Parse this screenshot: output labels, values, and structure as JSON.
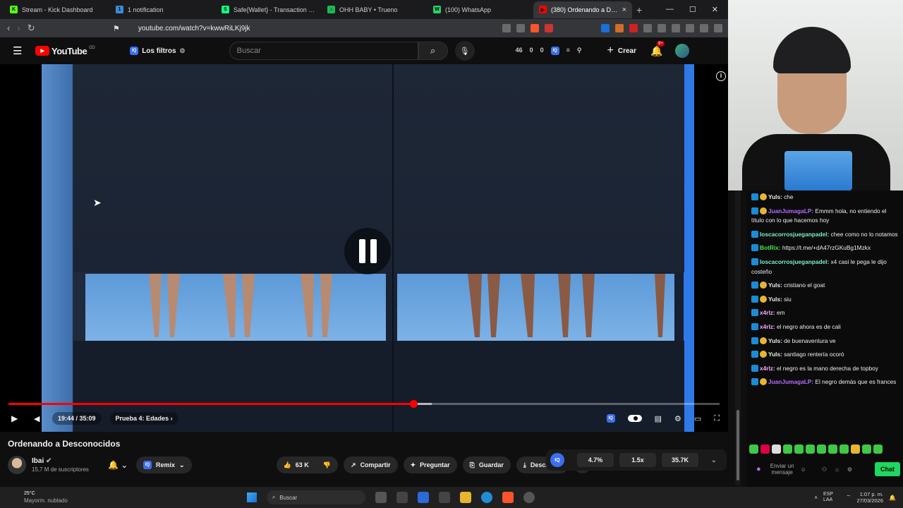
{
  "browser": {
    "tabs": [
      {
        "title": "Stream - Kick Dashboard",
        "icon_color": "#53fc18",
        "icon": "K"
      },
      {
        "title": "1 notification",
        "icon_color": "#3b8bd8",
        "icon": "1"
      },
      {
        "title": "Safe{Wallet} - Transaction queue",
        "icon_color": "#12ff80",
        "icon": "S"
      },
      {
        "title": "OHH BABY • Trueno",
        "icon_color": "#1db954",
        "icon": "♪"
      },
      {
        "title": "(100) WhatsApp",
        "icon_color": "#25d366",
        "icon": "W"
      },
      {
        "title": "(380) Ordenando a Desco...",
        "icon_color": "#ff0000",
        "icon": "▶",
        "active": true
      }
    ],
    "new_tab": "+",
    "url": "youtube.com/watch?v=kwwRiLKj9jk"
  },
  "yt_header": {
    "logo": "YouTube",
    "country": "CO",
    "filters_label": "Los filtros",
    "search_placeholder": "Buscar",
    "stats": [
      "46",
      "0",
      "0"
    ],
    "create_label": "Crear",
    "notifications": "9+"
  },
  "player": {
    "time": "19:44 / 35:09",
    "chapter": "Prueba 4: Edades",
    "progress_fraction": 0.5693,
    "buffered_fraction": 0.5952
  },
  "video": {
    "title": "Ordenando a Desconocidos",
    "channel": "Ibai",
    "subscribers": "15,7 M de suscriptores",
    "remix": "Remix",
    "likes": "63 K",
    "share": "Compartir",
    "ask": "Preguntar",
    "save": "Guardar",
    "download": "Descargar"
  },
  "iq_widget": {
    "stats": [
      "4.7%",
      "1.5x",
      "35.7K"
    ]
  },
  "chat": {
    "messages": [
      {
        "user": "Yuls:",
        "text": "che",
        "color": "#e9e9e9"
      },
      {
        "user": "JuanJumagaLP:",
        "text": "Emmm hola, no entiendo el título con lo que hacemos hoy",
        "color": "#b46cff"
      },
      {
        "user": "loscacorrosjueganpadel:",
        "text": "chee como no lo notamos",
        "color": "#7cf0c8"
      },
      {
        "user": "BotRix:",
        "text": "https://t.me/+dA47rzGKuBg1Mzkx",
        "color": "#49e44b"
      },
      {
        "user": "loscacorrosjueganpadel:",
        "text": "x4 casi le pega le dijo costeño",
        "color": "#7cf0c8"
      },
      {
        "user": "Yuls:",
        "text": "cristiano el goat",
        "color": "#e9e9e9"
      },
      {
        "user": "Yuls:",
        "text": "siu",
        "color": "#e9e9e9"
      },
      {
        "user": "x4rlz:",
        "text": "em",
        "color": "#f0a8ff"
      },
      {
        "user": "x4rlz:",
        "text": "el negro ahora es de cali",
        "color": "#f0a8ff"
      },
      {
        "user": "Yuls:",
        "text": "de buenaventura ve",
        "color": "#e9e9e9"
      },
      {
        "user": "Yuls:",
        "text": "santiago rentería ocoró",
        "color": "#e9e9e9"
      },
      {
        "user": "x4rlz:",
        "text": "el negro es la mano derecha de topboy",
        "color": "#f0a8ff"
      },
      {
        "user": "JuanJumagaLP:",
        "text": "El negro demás que es frances",
        "color": "#b46cff"
      }
    ],
    "input_placeholder": "Enviar un mensaje",
    "send_label": "Chat"
  },
  "taskbar": {
    "temperature": "25°C",
    "weather": "Mayorm. nublado",
    "search": "Buscar",
    "lang": "ESP LAA",
    "time": "1:07 p. m.",
    "date": "27/03/2026"
  }
}
